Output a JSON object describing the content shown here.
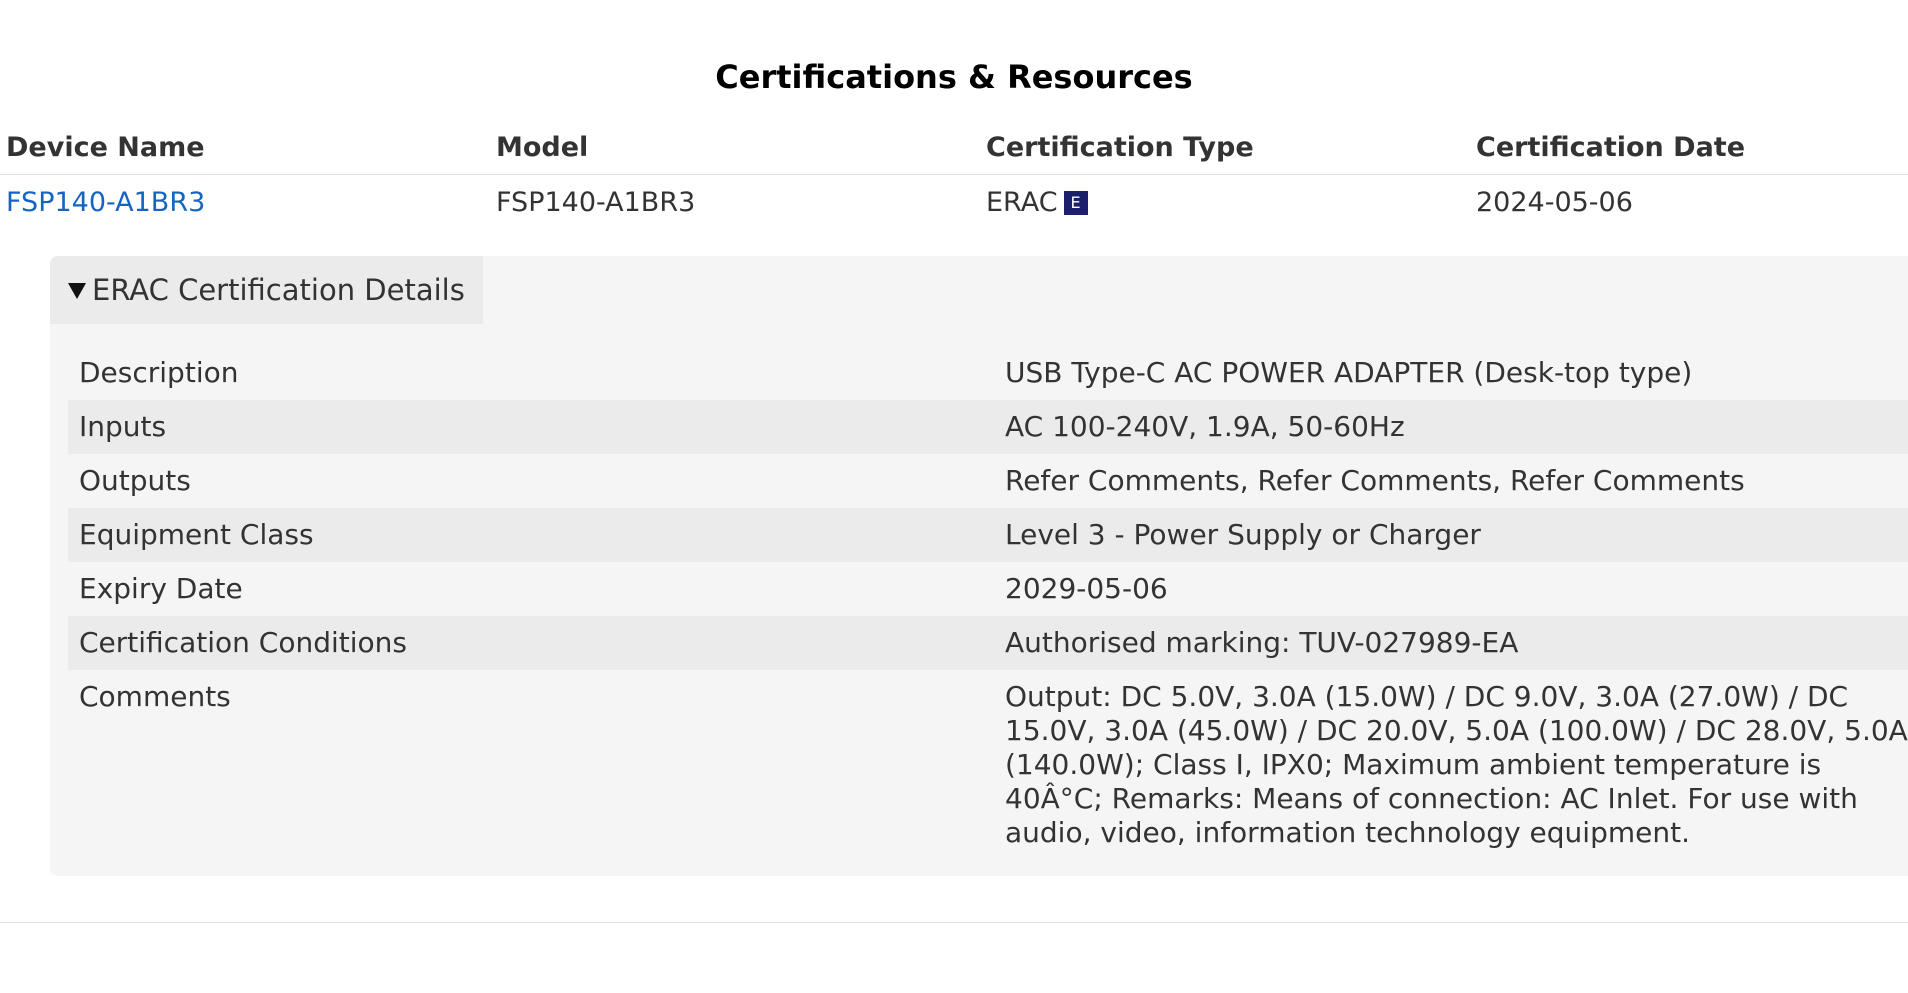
{
  "section": {
    "title": "Certifications & Resources"
  },
  "table": {
    "headers": [
      "Device Name",
      "Model",
      "Certification Type",
      "Certification Date"
    ],
    "rows": [
      {
        "device_name": "FSP140-A1BR3",
        "model": "FSP140-A1BR3",
        "certification_type": "ERAC",
        "badge": "E",
        "certification_date": "2024-05-06"
      }
    ]
  },
  "details": {
    "summary": "ERAC Certification Details",
    "rows": [
      {
        "label": "Description",
        "value": "USB Type-C AC POWER ADAPTER (Desk-top type)"
      },
      {
        "label": "Inputs",
        "value": "AC 100-240V, 1.9A, 50-60Hz"
      },
      {
        "label": "Outputs",
        "value": "Refer Comments, Refer Comments, Refer Comments"
      },
      {
        "label": "Equipment Class",
        "value": "Level 3 - Power Supply or Charger"
      },
      {
        "label": "Expiry Date",
        "value": "2029-05-06"
      },
      {
        "label": "Certification Conditions",
        "value": "Authorised marking: TUV-027989-EA"
      },
      {
        "label": "Comments",
        "value": "Output: DC 5.0V, 3.0A (15.0W) / DC 9.0V, 3.0A (27.0W) / DC 15.0V, 3.0A (45.0W) / DC 20.0V, 5.0A (100.0W) / DC 28.0V, 5.0A (140.0W); Class I, IPX0; Maximum ambient temperature is 40Â°C; Remarks: Means of connection: AC Inlet. For use with audio, video, information technology equipment."
      }
    ]
  },
  "colors": {
    "link": "#1565c0",
    "badge_bg": "#1c1f6b",
    "panel_bg": "#f5f5f5",
    "stripe_bg": "#ebebeb"
  },
  "icons": {
    "disclosure": "triangle-down-icon",
    "badge": "erac-badge-icon"
  }
}
